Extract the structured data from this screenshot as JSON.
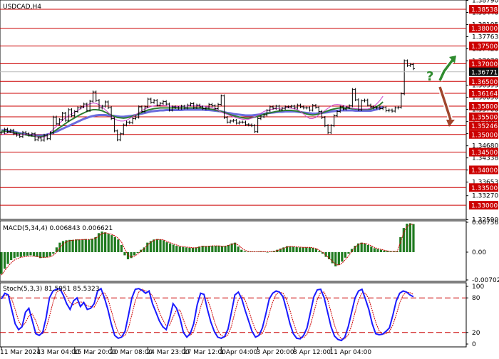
{
  "title": "USDCAD,H4",
  "price_panel": {
    "axis_labels": [
      {
        "label": "1.38790",
        "value": 1.3879
      },
      {
        "label": "1.38448",
        "value": 1.38448
      },
      {
        "label": "1.38105",
        "value": 1.38105
      },
      {
        "label": "1.37763",
        "value": 1.37763
      },
      {
        "label": "1.37420",
        "value": 1.3742
      },
      {
        "label": "1.37078",
        "value": 1.37078
      },
      {
        "label": "1.36393",
        "value": 1.36393
      },
      {
        "label": "1.36050",
        "value": 1.3605
      },
      {
        "label": "1.35708",
        "value": 1.35708
      },
      {
        "label": "1.35365",
        "value": 1.35365
      },
      {
        "label": "1.35023",
        "value": 1.35023
      },
      {
        "label": "1.34680",
        "value": 1.3468
      },
      {
        "label": "1.34338",
        "value": 1.34338
      },
      {
        "label": "1.33995",
        "value": 1.33995
      },
      {
        "label": "1.33653",
        "value": 1.33653
      },
      {
        "label": "1.33270",
        "value": 1.3327
      },
      {
        "label": "1.32590",
        "value": 1.3259
      }
    ],
    "levels": [
      {
        "label": "1.38538",
        "value": 1.38538
      },
      {
        "label": "1.38000",
        "value": 1.38
      },
      {
        "label": "1.37500",
        "value": 1.375
      },
      {
        "label": "1.37000",
        "value": 1.37
      },
      {
        "label": "1.36500",
        "value": 1.365
      },
      {
        "label": "1.36164",
        "value": 1.36164
      },
      {
        "label": "1.35800",
        "value": 1.358
      },
      {
        "label": "1.35500",
        "value": 1.355
      },
      {
        "label": "1.35246",
        "value": 1.35246
      },
      {
        "label": "1.35000",
        "value": 1.35
      },
      {
        "label": "1.34500",
        "value": 1.345
      },
      {
        "label": "1.34000",
        "value": 1.34
      },
      {
        "label": "1.33500",
        "value": 1.335
      },
      {
        "label": "1.33000",
        "value": 1.33
      }
    ],
    "current_price": {
      "label": "1.36771",
      "value": 1.36771
    },
    "colors": {
      "level": "#cc0000",
      "tag": "#cc0000",
      "current": "#111111",
      "ma_fast": "#cc44cc",
      "ma_mid": "#2e7d32",
      "ma_slow": "#6b6bdd",
      "arrow_up": "#2e8b2e",
      "arrow_down": "#a0462d"
    },
    "closes": [
      1.3505,
      1.3515,
      1.3508,
      1.3512,
      1.3502,
      1.3498,
      1.3494,
      1.3506,
      1.3502,
      1.3498,
      1.3502,
      1.3485,
      1.349,
      1.3484,
      1.3498,
      1.3488,
      1.3505,
      1.3549,
      1.353,
      1.3542,
      1.356,
      1.354,
      1.357,
      1.3553,
      1.3565,
      1.3575,
      1.3578,
      1.3586,
      1.3568,
      1.3594,
      1.362,
      1.3596,
      1.3575,
      1.358,
      1.3592,
      1.3576,
      1.3545,
      1.351,
      1.3485,
      1.3502,
      1.3527,
      1.3535,
      1.3533,
      1.3545,
      1.3549,
      1.3578,
      1.3565,
      1.3578,
      1.36,
      1.3591,
      1.3596,
      1.3583,
      1.3588,
      1.3593,
      1.3586,
      1.3569,
      1.3578,
      1.3576,
      1.3574,
      1.358,
      1.3575,
      1.3583,
      1.3587,
      1.3576,
      1.3583,
      1.3578,
      1.3573,
      1.3575,
      1.3585,
      1.3581,
      1.3573,
      1.3585,
      1.3609,
      1.3548,
      1.3535,
      1.3538,
      1.354,
      1.3532,
      1.3535,
      1.3535,
      1.3528,
      1.3527,
      1.3525,
      1.3508,
      1.3545,
      1.355,
      1.3555,
      1.3568,
      1.3578,
      1.3574,
      1.358,
      1.357,
      1.3574,
      1.3578,
      1.3578,
      1.358,
      1.3575,
      1.3583,
      1.3578,
      1.3575,
      1.3575,
      1.3569,
      1.3582,
      1.3577,
      1.3565,
      1.3548,
      1.3525,
      1.3505,
      1.3525,
      1.3553,
      1.3565,
      1.3578,
      1.3572,
      1.3576,
      1.3581,
      1.3627,
      1.3598,
      1.357,
      1.3595,
      1.3597,
      1.3583,
      1.3578,
      1.3575,
      1.3576,
      1.3573,
      1.3576,
      1.3567,
      1.3569,
      1.3566,
      1.3575,
      1.3577,
      1.3615,
      1.3708,
      1.3695,
      1.3698,
      1.3686
    ],
    "ma_fast": [
      1.3498,
      1.3502,
      1.3504,
      1.3505,
      1.3503,
      1.3501,
      1.35,
      1.35,
      1.3501,
      1.35,
      1.3499,
      1.3496,
      1.3493,
      1.3492,
      1.3493,
      1.3497,
      1.3505,
      1.3515,
      1.3523,
      1.3531,
      1.354,
      1.3547,
      1.3553,
      1.3558,
      1.3563,
      1.3568,
      1.3573,
      1.3578,
      1.3583,
      1.3587,
      1.3589,
      1.3588,
      1.3584,
      1.3578,
      1.357,
      1.3562,
      1.3553,
      1.3545,
      1.354,
      1.3538,
      1.3538,
      1.354,
      1.3545,
      1.355,
      1.3556,
      1.3562,
      1.3567,
      1.3572,
      1.3576,
      1.3579,
      1.3581,
      1.3582,
      1.3582,
      1.3582,
      1.3581,
      1.358,
      1.3579,
      1.3579,
      1.3579,
      1.3579,
      1.358,
      1.358,
      1.3581,
      1.3581,
      1.3581,
      1.3581,
      1.358,
      1.3579,
      1.3578,
      1.3576,
      1.3572,
      1.3568,
      1.3563,
      1.356,
      1.3557,
      1.3553,
      1.355,
      1.3547,
      1.3545,
      1.3543,
      1.3542,
      1.3543,
      1.3546,
      1.355,
      1.3555,
      1.356,
      1.3565,
      1.3568,
      1.357,
      1.3572,
      1.3573,
      1.3574,
      1.3574,
      1.3575,
      1.3575,
      1.3574,
      1.3573,
      1.357,
      1.3565,
      1.3558,
      1.355,
      1.3545,
      1.3545,
      1.3548,
      1.3555,
      1.3562,
      1.3568,
      1.3574,
      1.358,
      1.3584,
      1.3585,
      1.3584,
      1.3582,
      1.3579,
      1.3576,
      1.3574,
      1.3573,
      1.3572,
      1.3572,
      1.3572,
      1.3572,
      1.3574,
      1.3579,
      1.3587,
      1.3596,
      1.3608
    ],
    "ma_mid": [
      1.351,
      1.3509,
      1.3508,
      1.3507,
      1.3506,
      1.3504,
      1.3502,
      1.35,
      1.3499,
      1.3497,
      1.3496,
      1.3495,
      1.3494,
      1.3494,
      1.3495,
      1.3498,
      1.3502,
      1.3507,
      1.3513,
      1.3519,
      1.3525,
      1.3531,
      1.3537,
      1.3542,
      1.3547,
      1.3552,
      1.3557,
      1.3561,
      1.3565,
      1.3568,
      1.357,
      1.357,
      1.3569,
      1.3567,
      1.3563,
      1.3559,
      1.3555,
      1.3551,
      1.3548,
      1.3547,
      1.3546,
      1.3547,
      1.3549,
      1.3552,
      1.3555,
      1.3559,
      1.3562,
      1.3566,
      1.3569,
      1.3571,
      1.3573,
      1.3574,
      1.3575,
      1.3575,
      1.3575,
      1.3575,
      1.3575,
      1.3575,
      1.3575,
      1.3575,
      1.3575,
      1.3575,
      1.3575,
      1.3575,
      1.3575,
      1.3575,
      1.3574,
      1.3573,
      1.3572,
      1.3571,
      1.3569,
      1.3567,
      1.3565,
      1.3562,
      1.3559,
      1.3556,
      1.3553,
      1.3551,
      1.3549,
      1.3547,
      1.3546,
      1.3546,
      1.3547,
      1.3549,
      1.3551,
      1.3554,
      1.3557,
      1.3559,
      1.3561,
      1.3563,
      1.3565,
      1.3566,
      1.3567,
      1.3568,
      1.3568,
      1.3568,
      1.3567,
      1.3566,
      1.3564,
      1.3561,
      1.3558,
      1.3556,
      1.3555,
      1.3556,
      1.3558,
      1.3561,
      1.3564,
      1.3567,
      1.357,
      1.3572,
      1.3574,
      1.3575,
      1.3575,
      1.3575,
      1.3574,
      1.3573,
      1.3572,
      1.3571,
      1.3571,
      1.3571,
      1.3571,
      1.3572,
      1.3575,
      1.3579,
      1.3584,
      1.3592
    ],
    "ma_slow": [
      1.3512,
      1.3511,
      1.351,
      1.3509,
      1.3508,
      1.3506,
      1.3504,
      1.3502,
      1.35,
      1.3499,
      1.3498,
      1.3497,
      1.3497,
      1.3497,
      1.3498,
      1.35,
      1.3502,
      1.3505,
      1.3508,
      1.3512,
      1.3516,
      1.352,
      1.3524,
      1.3528,
      1.3532,
      1.3536,
      1.354,
      1.3544,
      1.3547,
      1.355,
      1.3552,
      1.3554,
      1.3555,
      1.3555,
      1.3555,
      1.3554,
      1.3553,
      1.3552,
      1.3551,
      1.355,
      1.355,
      1.3551,
      1.3552,
      1.3553,
      1.3555,
      1.3557,
      1.3559,
      1.3561,
      1.3563,
      1.3565,
      1.3566,
      1.3567,
      1.3568,
      1.3568,
      1.3569,
      1.3569,
      1.3569,
      1.3569,
      1.3569,
      1.3569,
      1.357,
      1.357,
      1.357,
      1.357,
      1.357,
      1.357,
      1.357,
      1.3569,
      1.3569,
      1.3568,
      1.3567,
      1.3566,
      1.3565,
      1.3563,
      1.3561,
      1.356,
      1.3558,
      1.3557,
      1.3556,
      1.3555,
      1.3554,
      1.3554,
      1.3554,
      1.3555,
      1.3556,
      1.3557,
      1.3558,
      1.356,
      1.3561,
      1.3562,
      1.3563,
      1.3564,
      1.3564,
      1.3565,
      1.3565,
      1.3565,
      1.3565,
      1.3564,
      1.3563,
      1.3562,
      1.3561,
      1.356,
      1.3559,
      1.3559,
      1.356,
      1.3561,
      1.3562,
      1.3563,
      1.3565,
      1.3566,
      1.3567,
      1.3568,
      1.3568,
      1.3568,
      1.3568,
      1.3568,
      1.3567,
      1.3567,
      1.3567,
      1.3567,
      1.3567,
      1.3567,
      1.3569,
      1.3571,
      1.3574,
      1.3578
    ]
  },
  "macd_panel": {
    "label": "MACD(5,34,4) 0.006843 0.006621",
    "axis_labels": [
      {
        "label": "0.00756",
        "value": 0.00756
      },
      {
        "label": "0.00",
        "value": 0.0
      },
      {
        "label": "-0.007027",
        "value": -0.007027
      }
    ],
    "histogram": [
      -0.0055,
      -0.0042,
      -0.003,
      -0.002,
      -0.0015,
      -0.0012,
      -0.0012,
      -0.001,
      -0.0009,
      -0.0008,
      -0.001,
      -0.0012,
      -0.0015,
      -0.0014,
      -0.0013,
      -0.001,
      -0.0004,
      0.0012,
      0.0024,
      0.0028,
      0.003,
      0.0031,
      0.0031,
      0.0032,
      0.0032,
      0.0032,
      0.0033,
      0.0032,
      0.0034,
      0.0038,
      0.0048,
      0.0052,
      0.005,
      0.0046,
      0.0043,
      0.0038,
      0.0032,
      0.0018,
      -0.0008,
      -0.0018,
      -0.0015,
      -0.0008,
      -0.0002,
      0.0006,
      0.0012,
      0.0024,
      0.0028,
      0.0032,
      0.0033,
      0.0032,
      0.003,
      0.0025,
      0.0022,
      0.0019,
      0.0016,
      0.0014,
      0.0013,
      0.0012,
      0.0011,
      0.0011,
      0.0012,
      0.0014,
      0.0016,
      0.0015,
      0.0016,
      0.0016,
      0.0016,
      0.0016,
      0.0015,
      0.0016,
      0.0018,
      0.0022,
      0.0024,
      0.0014,
      0.0006,
      0.0002,
      0.0001,
      0.0001,
      0.0001,
      0.0001,
      0.0002,
      0.0001,
      0.0,
      0.0001,
      0.0003,
      0.0006,
      0.0009,
      0.0012,
      0.0015,
      0.0015,
      0.0014,
      0.0013,
      0.0012,
      0.0012,
      0.0012,
      0.0012,
      0.0011,
      0.0008,
      0.0003,
      -0.0004,
      -0.0012,
      -0.0018,
      -0.0028,
      -0.0036,
      -0.0032,
      -0.0024,
      -0.0014,
      -0.0004,
      0.0008,
      0.0016,
      0.0022,
      0.0024,
      0.0022,
      0.0018,
      0.0014,
      0.001,
      0.0008,
      0.0006,
      0.0004,
      0.0003,
      0.0002,
      0.0002,
      0.0002,
      0.0038,
      0.0061,
      0.0072,
      0.0073,
      0.0071
    ],
    "signal": [
      -0.0058,
      -0.0047,
      -0.0036,
      -0.0027,
      -0.002,
      -0.0016,
      -0.0013,
      -0.0012,
      -0.0011,
      -0.001,
      -0.001,
      -0.0011,
      -0.0013,
      -0.0013,
      -0.0013,
      -0.0012,
      -0.0008,
      0.0,
      0.0011,
      0.002,
      0.0026,
      0.0029,
      0.003,
      0.0031,
      0.0031,
      0.0032,
      0.0032,
      0.0032,
      0.0033,
      0.0035,
      0.0041,
      0.0047,
      0.0049,
      0.0047,
      0.0045,
      0.0041,
      0.0035,
      0.0026,
      0.0008,
      -0.0008,
      -0.0013,
      -0.001,
      -0.0005,
      0.0002,
      0.0009,
      0.0018,
      0.0025,
      0.003,
      0.0032,
      0.0032,
      0.0031,
      0.0027,
      0.0024,
      0.0021,
      0.0018,
      0.0015,
      0.0014,
      0.0013,
      0.0012,
      0.0011,
      0.0011,
      0.0013,
      0.0015,
      0.0015,
      0.0015,
      0.0016,
      0.0016,
      0.0016,
      0.0015,
      0.0015,
      0.0017,
      0.002,
      0.0022,
      0.0018,
      0.0011,
      0.0005,
      0.0002,
      0.0001,
      0.0001,
      0.0001,
      0.0001,
      0.0001,
      0.0001,
      0.0001,
      0.0002,
      0.0004,
      0.0007,
      0.001,
      0.0013,
      0.0014,
      0.0014,
      0.0013,
      0.0013,
      0.0012,
      0.0012,
      0.0012,
      0.0011,
      0.0009,
      0.0005,
      0.0,
      -0.0008,
      -0.0015,
      -0.0023,
      -0.0031,
      -0.0033,
      -0.0028,
      -0.0019,
      -0.001,
      0.0002,
      0.0012,
      0.0019,
      0.0023,
      0.0022,
      0.002,
      0.0016,
      0.0012,
      0.0009,
      0.0007,
      0.0005,
      0.0003,
      0.0002,
      0.0002,
      0.0002,
      0.0025,
      0.0049,
      0.0064,
      0.007,
      0.0071
    ],
    "colors": {
      "histogram": "#1f7a1f",
      "signal": "#cc0000"
    }
  },
  "stoch_panel": {
    "label": "Stoch(5,3,3) 81.5951 85.5323",
    "axis_labels": [
      {
        "label": "100",
        "value": 100
      },
      {
        "label": "80",
        "value": 80
      },
      {
        "label": "20",
        "value": 20
      },
      {
        "label": "0",
        "value": 0
      }
    ],
    "levels": [
      80,
      20
    ],
    "main": [
      78,
      88,
      85,
      60,
      35,
      25,
      30,
      55,
      62,
      40,
      18,
      15,
      20,
      45,
      80,
      92,
      95,
      96,
      85,
      70,
      60,
      75,
      80,
      65,
      72,
      60,
      62,
      70,
      92,
      96,
      80,
      60,
      35,
      15,
      10,
      12,
      22,
      50,
      80,
      95,
      96,
      93,
      88,
      92,
      70,
      55,
      40,
      30,
      25,
      45,
      70,
      62,
      45,
      20,
      12,
      18,
      35,
      68,
      88,
      86,
      60,
      38,
      22,
      12,
      10,
      13,
      26,
      55,
      85,
      90,
      78,
      58,
      40,
      22,
      12,
      15,
      28,
      52,
      78,
      88,
      92,
      90,
      82,
      60,
      36,
      18,
      10,
      9,
      15,
      28,
      55,
      82,
      94,
      95,
      80,
      55,
      30,
      14,
      8,
      6,
      12,
      30,
      55,
      80,
      92,
      95,
      78,
      60,
      35,
      18,
      16,
      17,
      22,
      28,
      50,
      75,
      88,
      92,
      90,
      85,
      82
    ],
    "signal": [
      82,
      84,
      85,
      78,
      60,
      40,
      30,
      37,
      49,
      52,
      40,
      24,
      18,
      27,
      48,
      72,
      89,
      94,
      92,
      83,
      72,
      68,
      72,
      73,
      72,
      66,
      65,
      64,
      75,
      86,
      89,
      79,
      58,
      37,
      20,
      12,
      15,
      28,
      51,
      75,
      90,
      95,
      92,
      91,
      83,
      72,
      55,
      42,
      32,
      33,
      47,
      59,
      59,
      42,
      26,
      15,
      22,
      41,
      64,
      81,
      78,
      61,
      40,
      24,
      15,
      12,
      16,
      31,
      55,
      77,
      84,
      75,
      59,
      40,
      25,
      16,
      18,
      32,
      53,
      73,
      86,
      90,
      88,
      77,
      59,
      38,
      21,
      12,
      11,
      17,
      33,
      55,
      77,
      90,
      90,
      77,
      55,
      33,
      17,
      9,
      9,
      16,
      32,
      55,
      76,
      89,
      88,
      78,
      58,
      38,
      23,
      17,
      18,
      22,
      33,
      51,
      71,
      85,
      90,
      89,
      86
    ],
    "colors": {
      "main": "#1a1aff",
      "signal": "#cc0000",
      "levels": "#cc0000"
    }
  },
  "time_axis": [
    {
      "label": "11 Mar 2024",
      "index": 0
    },
    {
      "label": "13 Mar 04:00",
      "index": 12
    },
    {
      "label": "15 Mar 20:00",
      "index": 24
    },
    {
      "label": "20 Mar 08:00",
      "index": 36
    },
    {
      "label": "24 Mar 23:00",
      "index": 48
    },
    {
      "label": "27 Mar 12:00",
      "index": 60
    },
    {
      "label": "1 Apr 04:00",
      "index": 72
    },
    {
      "label": "3 Apr 20:00",
      "index": 84
    },
    {
      "label": "8 Apr 12:00",
      "index": 96
    },
    {
      "label": "11 Apr 04:00",
      "index": 108
    }
  ],
  "annotation": {
    "question_mark": "?"
  }
}
